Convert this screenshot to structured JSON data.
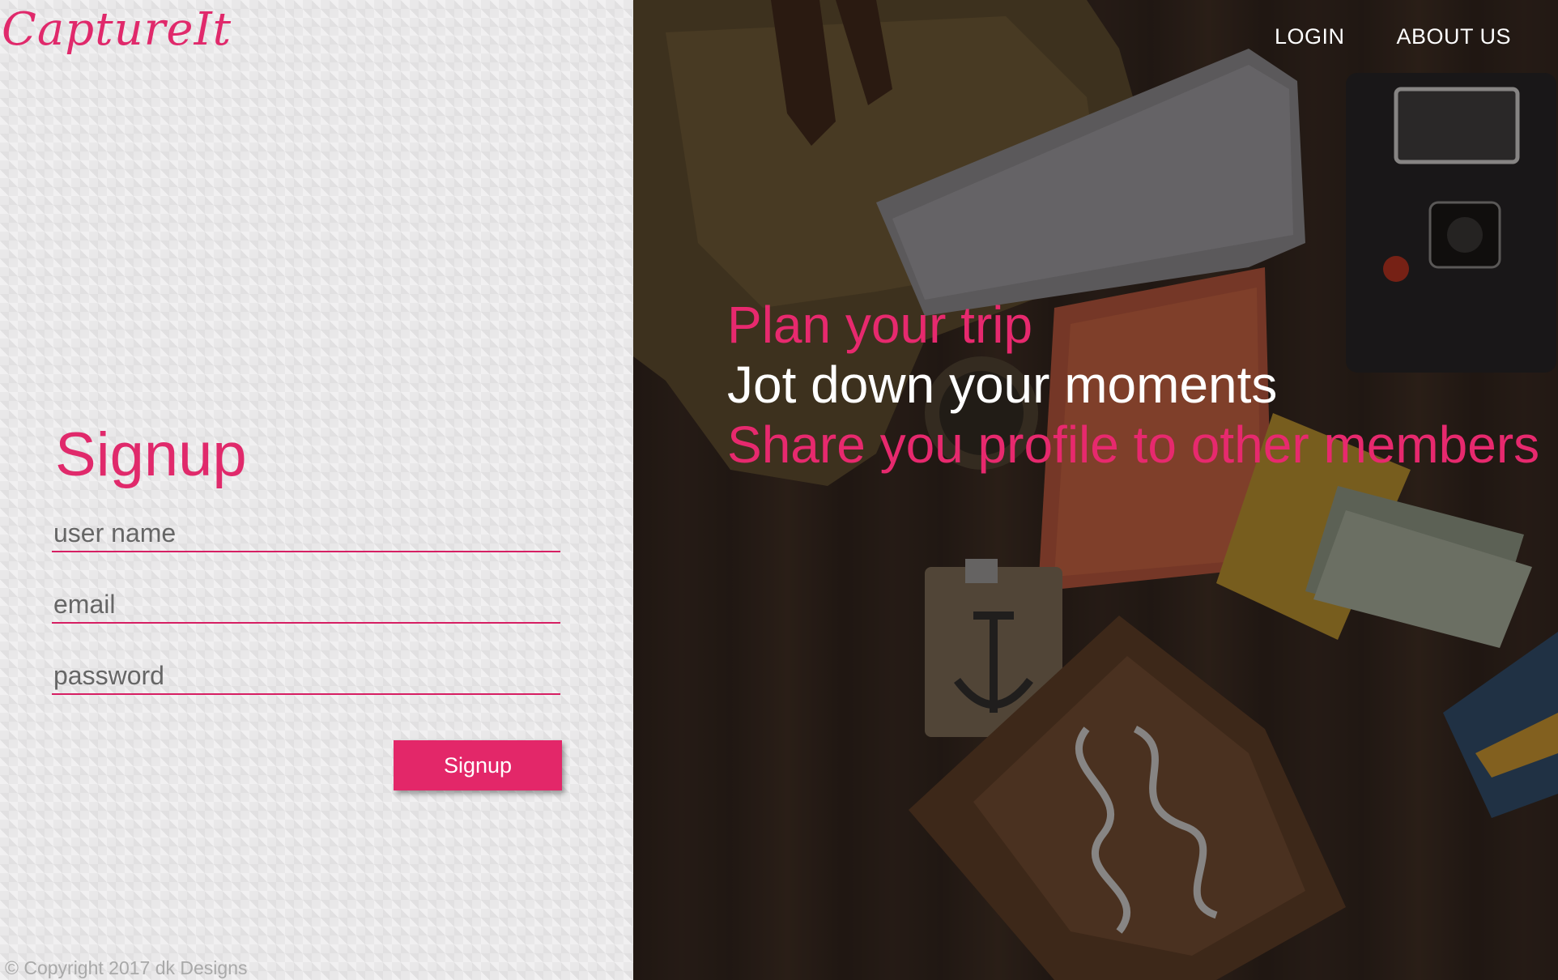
{
  "brand": {
    "logo_text": "CaptureIt",
    "accent_color": "#e32769"
  },
  "signup_form": {
    "title": "Signup",
    "username_placeholder": "user name",
    "email_placeholder": "email",
    "password_placeholder": "password",
    "submit_label": "Signup"
  },
  "footer": {
    "copyright": "© Copyright 2017 dk Designs"
  },
  "nav": {
    "items": [
      {
        "label": "LOGIN"
      },
      {
        "label": "ABOUT US"
      }
    ]
  },
  "hero": {
    "lines": [
      {
        "text": "Plan your trip",
        "color": "#e7296e"
      },
      {
        "text": "Jot down your moments",
        "color": "#ffffff"
      },
      {
        "text": "Share you profile to other members",
        "color": "#e7296e"
      }
    ]
  }
}
